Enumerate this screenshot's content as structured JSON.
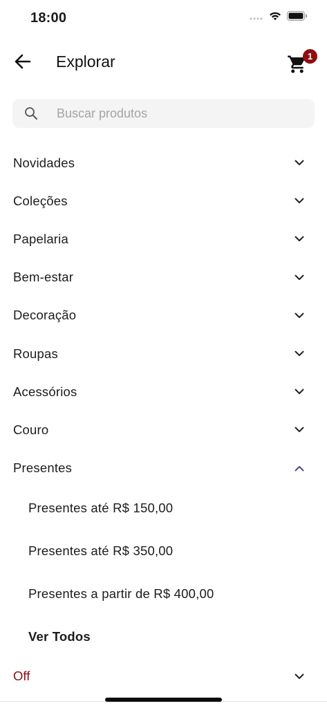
{
  "status_bar": {
    "time": "18:00"
  },
  "header": {
    "title": "Explorar",
    "back_icon": "arrow-left-icon",
    "cart_icon": "shopping-cart-icon",
    "cart_count": "1"
  },
  "search": {
    "placeholder": "Buscar produtos",
    "value": "",
    "icon": "search-icon"
  },
  "categories": [
    {
      "label": "Novidades",
      "expanded": false
    },
    {
      "label": "Coleções",
      "expanded": false
    },
    {
      "label": "Papelaria",
      "expanded": false
    },
    {
      "label": "Bem-estar",
      "expanded": false
    },
    {
      "label": "Decoração",
      "expanded": false
    },
    {
      "label": "Roupas",
      "expanded": false
    },
    {
      "label": "Acessórios",
      "expanded": false
    },
    {
      "label": "Couro",
      "expanded": false
    },
    {
      "label": "Presentes",
      "expanded": true
    }
  ],
  "presentes_sub": [
    {
      "label": "Presentes até R$ 150,00"
    },
    {
      "label": "Presentes até R$ 350,00"
    },
    {
      "label": "Presentes a partir de R$ 400,00"
    },
    {
      "label": "Ver Todos"
    }
  ],
  "off": {
    "label": "Off",
    "expanded": false
  },
  "colors": {
    "accent": "#8e0e12",
    "expanded_chevron": "#4a4a8c",
    "search_bg": "#f4f4f4"
  }
}
